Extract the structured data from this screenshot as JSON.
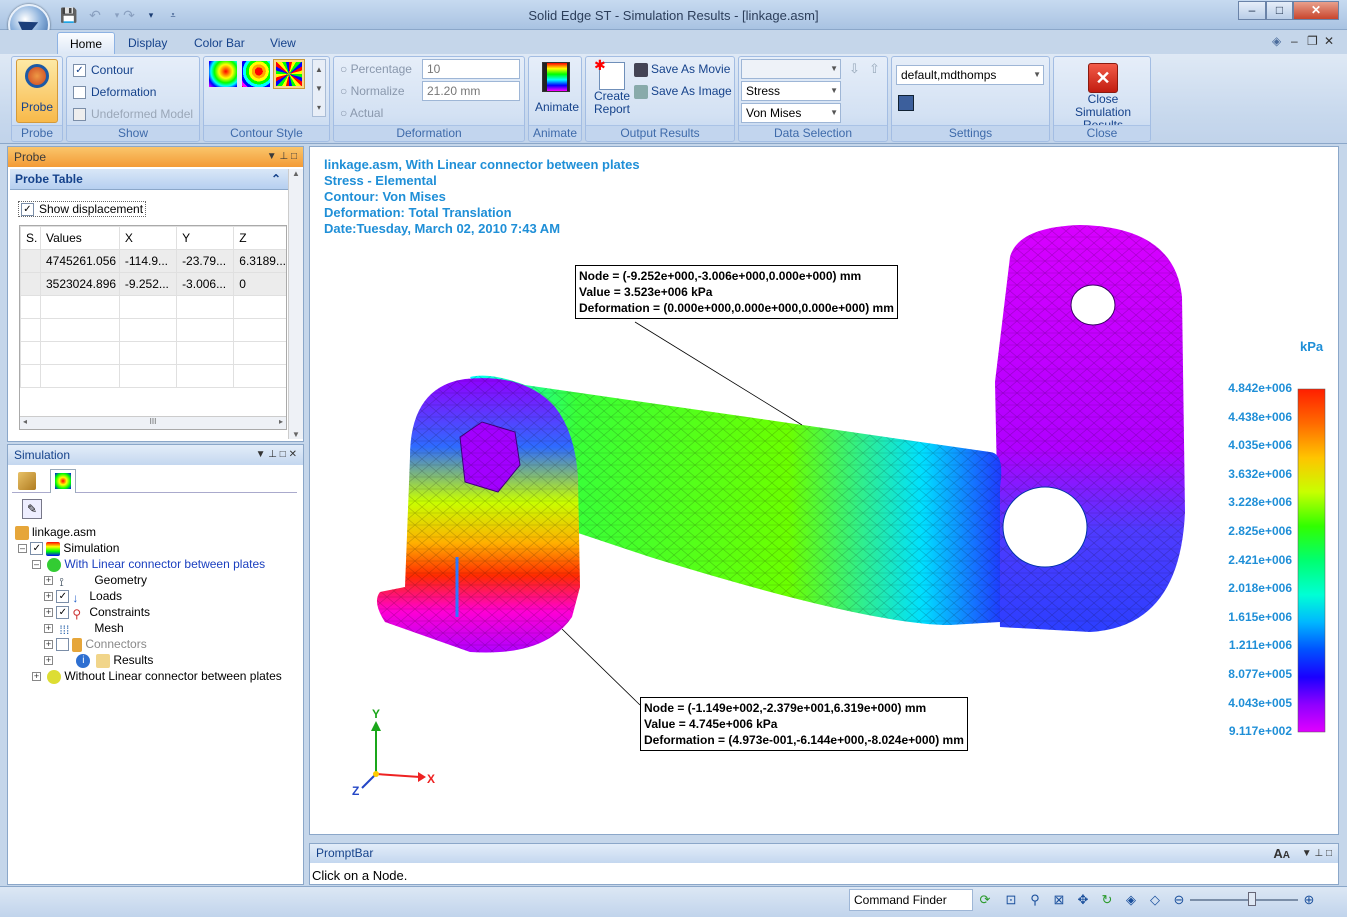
{
  "window": {
    "title": "Solid Edge ST - Simulation Results - [linkage.asm]",
    "controls": {
      "minimize": "–",
      "maximize": "□",
      "close": "✕"
    },
    "doc_controls": {
      "help": "◈",
      "minimize": "–",
      "restore": "❐",
      "close": "✕"
    }
  },
  "quick_access": [
    "save-icon",
    "undo-icon",
    "redo-icon",
    "customize-icon"
  ],
  "tabs": [
    {
      "label": "Home",
      "active": true
    },
    {
      "label": "Display"
    },
    {
      "label": "Color Bar"
    },
    {
      "label": "View"
    }
  ],
  "ribbon": {
    "probe": {
      "button": "Probe",
      "group": "Probe"
    },
    "show": {
      "contour": "Contour",
      "deformation": "Deformation",
      "undeformed": "Undeformed Model",
      "group": "Show"
    },
    "contour_style": {
      "group": "Contour Style"
    },
    "deformation": {
      "percentage": "Percentage",
      "percentage_value": "10",
      "normalize": "Normalize",
      "normalize_value": "21.20 mm",
      "actual": "Actual",
      "group": "Deformation"
    },
    "animate": {
      "button": "Animate",
      "group": "Animate"
    },
    "output": {
      "create_report": "Create Report",
      "save_movie": "Save As Movie",
      "save_image": "Save As Image",
      "group": "Output Results"
    },
    "data_selection": {
      "combo1": "",
      "combo2": "Stress",
      "combo3": "Von Mises",
      "group": "Data Selection"
    },
    "settings": {
      "profile": "default,mdthomps",
      "group": "Settings"
    },
    "close": {
      "button": "Close Simulation Results",
      "group": "Close"
    }
  },
  "probe_panel": {
    "title": "Probe",
    "table_title": "Probe Table",
    "show_displacement": "Show displacement",
    "columns": [
      "S.",
      "Values",
      "X",
      "Y",
      "Z"
    ],
    "rows": [
      [
        "",
        "4745261.056",
        "-114.9...",
        "-23.79...",
        "6.3189..."
      ],
      [
        "",
        "3523024.896",
        "-9.252...",
        "-3.006...",
        "0"
      ]
    ],
    "scroll_mark": "III"
  },
  "sim_panel": {
    "title": "Simulation",
    "tree": [
      {
        "label": "linkage.asm"
      },
      {
        "label": "Simulation"
      },
      {
        "label": "With Linear connector between plates"
      },
      {
        "label": "Geometry"
      },
      {
        "label": "Loads"
      },
      {
        "label": "Constraints"
      },
      {
        "label": "Mesh"
      },
      {
        "label": "Connectors"
      },
      {
        "label": "Results"
      },
      {
        "label": "Without Linear connector between plates"
      }
    ]
  },
  "viewport": {
    "header": [
      "linkage.asm, With Linear connector between plates",
      "Stress - Elemental",
      "Contour: Von Mises",
      "Deformation: Total Translation",
      "Date:Tuesday, March 02, 2010  7:43 AM"
    ],
    "callout1": [
      "Node = (-9.252e+000,-3.006e+000,0.000e+000) mm",
      "Value = 3.523e+006 kPa",
      "Deformation = (0.000e+000,0.000e+000,0.000e+000) mm"
    ],
    "callout2": [
      "Node = (-1.149e+002,-2.379e+001,6.319e+000) mm",
      "Value = 4.745e+006 kPa",
      "Deformation = (4.973e-001,-6.144e+000,-8.024e+000) mm"
    ],
    "legend_unit": "kPa",
    "legend_values": [
      "4.842e+006",
      "4.438e+006",
      "4.035e+006",
      "3.632e+006",
      "3.228e+006",
      "2.825e+006",
      "2.421e+006",
      "2.018e+006",
      "1.615e+006",
      "1.211e+006",
      "8.077e+005",
      "4.043e+005",
      "9.117e+002"
    ],
    "axis": {
      "x": "X",
      "y": "Y",
      "z": "Z"
    },
    "colors": {
      "header": "#1f8fd7",
      "legend": [
        "#ff1f00",
        "#ff6a00",
        "#ffc400",
        "#c8ff00",
        "#31ff00",
        "#00ff70",
        "#00ffd5",
        "#00b7ff",
        "#0052ff",
        "#1a00ff",
        "#8f00ff",
        "#e000ff"
      ]
    }
  },
  "prompt": {
    "title": "PromptBar",
    "text": "Click on a Node.",
    "font_large": "A",
    "font_small": "A"
  },
  "status": {
    "command_finder": "Command Finder"
  }
}
